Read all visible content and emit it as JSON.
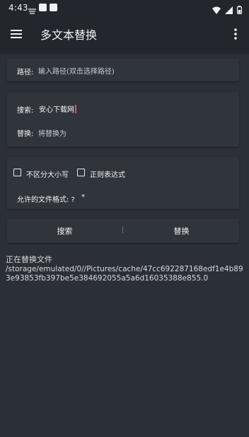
{
  "status_bar": {
    "time": "4:43"
  },
  "app_bar": {
    "title": "多文本替换",
    "menu_icon": "menu-icon",
    "more_icon": "more-vert-icon"
  },
  "path": {
    "label": "路径:",
    "placeholder": "输入路径(双击选择路径)"
  },
  "search": {
    "label": "搜索:",
    "value": "安心下载网"
  },
  "replace": {
    "label": "替换:",
    "placeholder": "将替换为"
  },
  "options": {
    "case_insensitive_label": "不区分大小写",
    "case_insensitive_checked": false,
    "regex_label": "正则表达式",
    "regex_checked": false,
    "allowed_formats_label": "允许的文件格式: ?",
    "allowed_formats_value": "*"
  },
  "buttons": {
    "search_label": "搜索",
    "replace_label": "替换"
  },
  "output": {
    "status": "正在替换文件",
    "path": "/storage/emulated/0//Pictures/cache/47cc692287168edf1e4b893e93853fb397be5e384692055a5a6d16035388e855.0"
  },
  "colors": {
    "background": "#2b2f36",
    "appbar": "#23262c",
    "card": "#30343b",
    "cursor": "#e04a7a"
  }
}
